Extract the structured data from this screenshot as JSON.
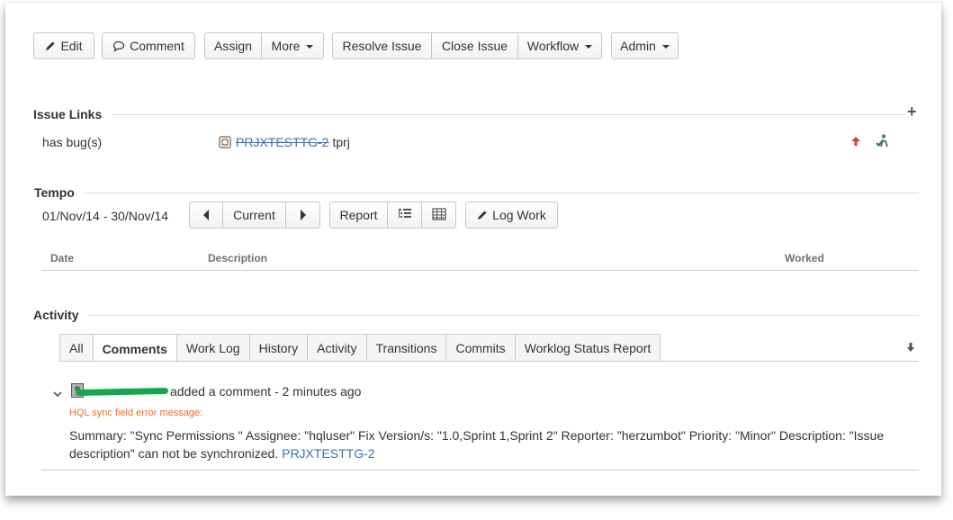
{
  "toolbar": {
    "edit": "Edit",
    "comment": "Comment",
    "assign": "Assign",
    "more": "More",
    "resolve": "Resolve Issue",
    "close": "Close Issue",
    "workflow": "Workflow",
    "admin": "Admin"
  },
  "issue_links": {
    "title": "Issue Links",
    "relation": "has bug(s)",
    "linked_key": "PRJXTESTTG-2",
    "linked_summary": "tprj",
    "add_symbol": "+"
  },
  "tempo": {
    "title": "Tempo",
    "date_range": "01/Nov/14 - 30/Nov/14",
    "prev_icon": "triangle-left-icon",
    "current": "Current",
    "next_icon": "triangle-right-icon",
    "report": "Report",
    "log_work": "Log Work",
    "columns": {
      "date": "Date",
      "description": "Description",
      "worked": "Worked"
    }
  },
  "activity": {
    "title": "Activity",
    "tabs": [
      "All",
      "Comments",
      "Work Log",
      "History",
      "Activity",
      "Transitions",
      "Commits",
      "Worklog Status Report"
    ],
    "active_tab": "Comments",
    "comment": {
      "action": "added a comment - 2 minutes ago",
      "error_label": "HQL sync field error message:",
      "body": "Summary: \"Sync Permissions \" Assignee: \"hqluser\" Fix Version/s: \"1.0,Sprint 1,Sprint 2\" Reporter: \"herzumbot\" Priority: \"Minor\" Description: \"Issue description\" can not be synchronized.",
      "body_link": "PRJXTESTTG-2"
    }
  },
  "colors": {
    "link": "#3b73af",
    "error": "#f36c21",
    "redaction": "#14a84a",
    "priority_arrow": "#d04437"
  }
}
